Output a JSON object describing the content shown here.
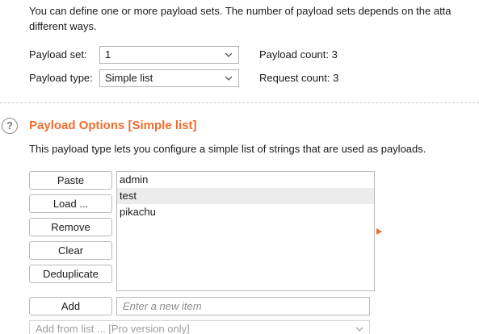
{
  "payload_sets": {
    "description_line1": "You can define one or more payload sets. The number of payload sets depends on the atta",
    "description_line2": "different ways.",
    "payload_set_label": "Payload set:",
    "payload_set_value": "1",
    "payload_type_label": "Payload type:",
    "payload_type_value": "Simple list",
    "payload_count_label": "Payload count:",
    "payload_count_value": "3",
    "request_count_label": "Request count:",
    "request_count_value": "3"
  },
  "payload_options": {
    "help_glyph": "?",
    "title": "Payload Options [Simple list]",
    "description": "This payload type lets you configure a simple list of strings that are used as payloads.",
    "buttons": {
      "paste": "Paste",
      "load": "Load ...",
      "remove": "Remove",
      "clear": "Clear",
      "deduplicate": "Deduplicate",
      "add": "Add"
    },
    "items": [
      "admin",
      "test",
      "pikachu"
    ],
    "selected_item": "test",
    "new_item_placeholder": "Enter a new item",
    "add_from_list": "Add from list ... [Pro version only]"
  },
  "colors": {
    "accent": "#f06d2e",
    "selection": "#ececec",
    "border": "#b9b9b9"
  },
  "icons": {
    "dropdown": "chevron-down-icon",
    "help": "help-circle-icon",
    "arrow": "play-arrow-icon"
  }
}
